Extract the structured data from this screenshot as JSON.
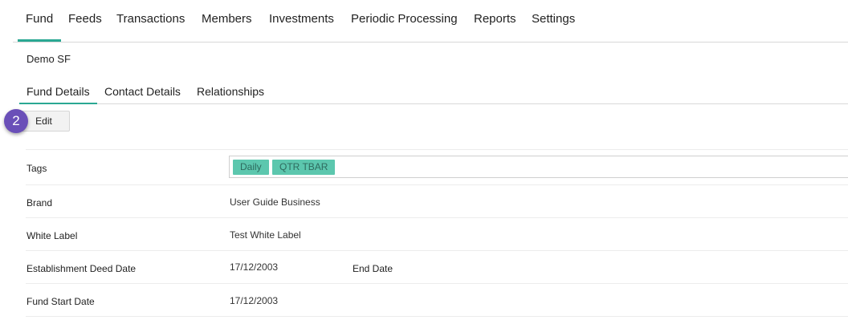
{
  "topnav": {
    "tabs": [
      {
        "label": "Fund",
        "active": true
      },
      {
        "label": "Feeds"
      },
      {
        "label": "Transactions"
      },
      {
        "label": "Members"
      },
      {
        "label": "Investments"
      },
      {
        "label": "Periodic Processing"
      },
      {
        "label": "Reports"
      },
      {
        "label": "Settings"
      }
    ]
  },
  "fund": {
    "name": "Demo SF"
  },
  "subtabs": [
    {
      "label": "Fund Details",
      "active": true
    },
    {
      "label": "Contact Details"
    },
    {
      "label": "Relationships"
    }
  ],
  "toolbar": {
    "edit_label": "Edit",
    "step_number": "2"
  },
  "details": {
    "tags": {
      "label": "Tags",
      "values": [
        "Daily",
        "QTR TBAR"
      ]
    },
    "brand": {
      "label": "Brand",
      "value": "User Guide Business"
    },
    "white_label": {
      "label": "White Label",
      "value": "Test White Label"
    },
    "establishment": {
      "label": "Establishment Deed Date",
      "value": "17/12/2003",
      "end_label": "End Date",
      "end_value": ""
    },
    "start": {
      "label": "Fund Start Date",
      "value": "17/12/2003"
    }
  },
  "colors": {
    "accent": "#2aa893",
    "tag_bg": "#5cc7ae",
    "badge": "#6a4fb8"
  }
}
